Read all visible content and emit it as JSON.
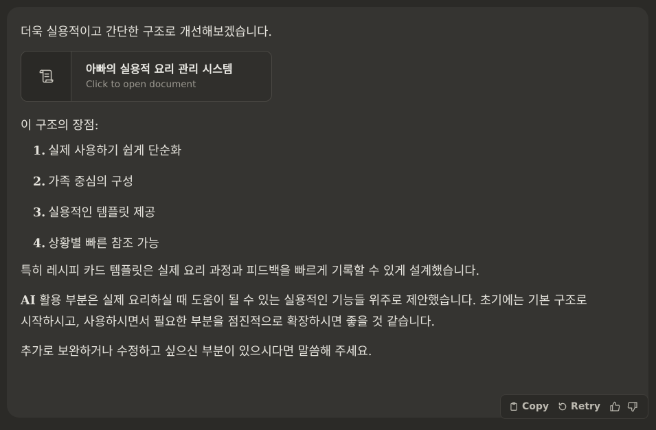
{
  "message": {
    "intro": "더욱 실용적이고 간단한 구조로 개선해보겠습니다.",
    "document_card": {
      "title": "아빠의 실용적 요리 관리 시스템",
      "subtitle": "Click to open document",
      "icon": "scroll-document-icon"
    },
    "pros_heading": "이 구조의 장점:",
    "pros": [
      {
        "num": "1.",
        "text": "실제 사용하기 쉽게 단순화"
      },
      {
        "num": "2.",
        "text": "가족 중심의 구성"
      },
      {
        "num": "3.",
        "text": "실용적인 템플릿 제공"
      },
      {
        "num": "4.",
        "text": "상황별 빠른 참조 가능"
      }
    ],
    "para_recipe": "특히 레시피 카드 템플릿은 실제 요리 과정과 피드백을 빠르게 기록할 수 있게 설계했습니다.",
    "para_ai_bold": "AI",
    "para_ai_rest": " 활용 부분은 실제 요리하실 때 도움이 될 수 있는 실용적인 기능들 위주로 제안했습니다. 초기에는 기본 구조로 시작하시고, 사용하시면서 필요한 부분을 점진적으로 확장하시면 좋을 것 같습니다.",
    "para_closing": "추가로 보완하거나 수정하고 싶으신 부분이 있으시다면 말씀해 주세요."
  },
  "actions": {
    "copy_label": "Copy",
    "retry_label": "Retry",
    "icons": [
      "clipboard-icon",
      "retry-icon",
      "thumbs-up-icon",
      "thumbs-down-icon"
    ]
  }
}
